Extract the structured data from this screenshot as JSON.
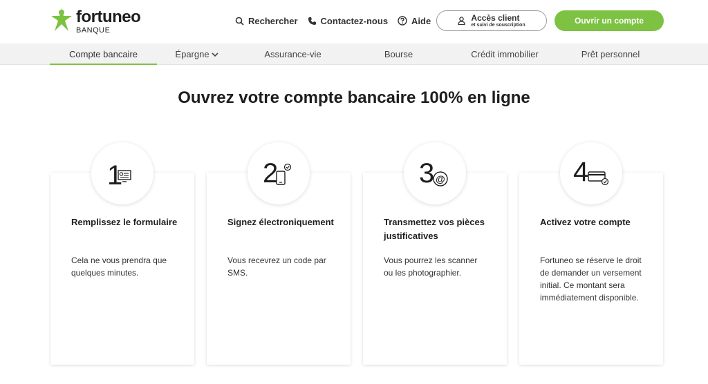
{
  "brand": {
    "name": "fortuneo",
    "sub": "BANQUE",
    "accent": "#7dc242"
  },
  "top_links": {
    "search": "Rechercher",
    "contact": "Contactez-nous",
    "help": "Aide"
  },
  "access_button": {
    "label": "Accès client",
    "sublabel": "et suivi de souscription"
  },
  "open_button": {
    "label": "Ouvrir un compte"
  },
  "nav": {
    "items": [
      {
        "label": "Compte bancaire"
      },
      {
        "label": "Épargne"
      },
      {
        "label": "Assurance-vie"
      },
      {
        "label": "Bourse"
      },
      {
        "label": "Crédit immobilier"
      },
      {
        "label": "Prêt personnel"
      }
    ]
  },
  "page_title": "Ouvrez votre compte bancaire 100% en ligne",
  "steps": [
    {
      "number": "1",
      "icon": "computer-form-icon",
      "title": "Remplissez le formulaire",
      "text": "Cela ne vous prendra que quelques minutes."
    },
    {
      "number": "2",
      "icon": "phone-signature-icon",
      "title": "Signez électroniquement",
      "text": "Vous recevrez un code par SMS."
    },
    {
      "number": "3",
      "icon": "at-sign-icon",
      "title": "Transmettez vos pièces justificatives",
      "text": "Vous pourrez les scanner ou les photographier."
    },
    {
      "number": "4",
      "icon": "card-check-icon",
      "title": "Activez votre compte",
      "text": "Fortuneo se réserve le droit de demander un versement initial. Ce montant sera immédiatement disponible."
    }
  ]
}
